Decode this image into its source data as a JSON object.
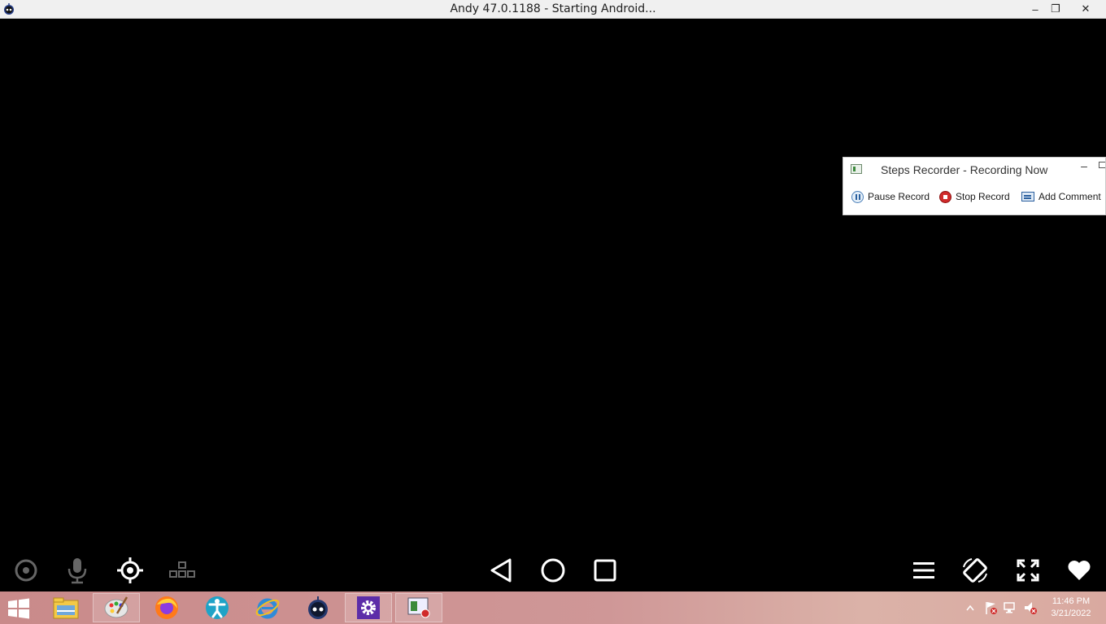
{
  "window": {
    "title": "Andy 47.0.1188 - Starting Android...",
    "controls": {
      "minimize": "‒",
      "maximize": "❐",
      "close": "✕"
    }
  },
  "android_toolbar": {
    "left": [
      "camera-icon",
      "microphone-icon",
      "gps-location-icon",
      "keymapping-icon"
    ],
    "center": [
      "back-icon",
      "home-icon",
      "recents-icon"
    ],
    "right": [
      "menu-icon",
      "rotate-icon",
      "fullscreen-icon",
      "favorite-heart-icon"
    ]
  },
  "steps_recorder": {
    "title": "Steps Recorder - Recording Now",
    "minimize": "‒",
    "pause_label": "Pause Record",
    "stop_label": "Stop Record",
    "comment_label": "Add Comment"
  },
  "taskbar": {
    "apps": [
      "file-explorer-icon",
      "paint-icon",
      "firefox-icon",
      "accessibility-icon",
      "internet-explorer-icon",
      "andy-icon",
      "settings-icon",
      "steps-recorder-icon"
    ],
    "tray": [
      "show-hidden-icons-icon",
      "action-center-flag-icon",
      "network-icon",
      "volume-muted-icon"
    ],
    "clock": {
      "time": "11:46 PM",
      "date": "3/21/2022"
    }
  },
  "colors": {
    "taskbar": "#c98a8a",
    "firefox_orange": "#ff7a1a",
    "settings_purple": "#5c2da8",
    "stop_red": "#d02a2a"
  }
}
